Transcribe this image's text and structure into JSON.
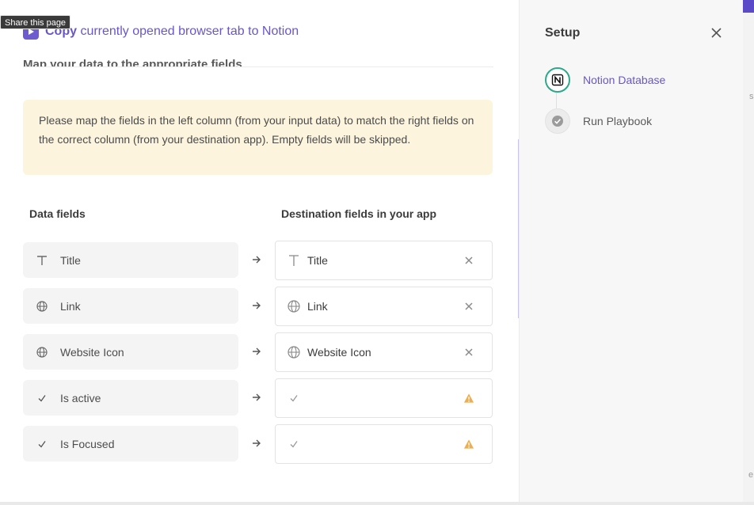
{
  "tooltip": "Share this page",
  "header": {
    "title_strong": "Copy",
    "title_rest": " currently opened browser tab to Notion"
  },
  "section_heading": "Map your data to the appropriate fields",
  "notice": "Please map the fields in the left column (from your input data) to match the right fields on the correct column (from your destination app). Empty fields will be skipped.",
  "columns": {
    "left": "Data fields",
    "right": "Destination fields in your app"
  },
  "rows": [
    {
      "source": "Title",
      "source_icon": "text-icon",
      "destination": "Title",
      "destination_icon": "text-icon",
      "action": "clear-icon"
    },
    {
      "source": "Link",
      "source_icon": "globe-icon",
      "destination": "Link",
      "destination_icon": "globe-icon",
      "action": "clear-icon"
    },
    {
      "source": "Website Icon",
      "source_icon": "globe-icon",
      "destination": "Website Icon",
      "destination_icon": "globe-icon",
      "action": "clear-icon"
    },
    {
      "source": "Is active",
      "source_icon": "check-icon",
      "destination": "",
      "destination_icon": "check-icon",
      "action": "warning-icon"
    },
    {
      "source": "Is Focused",
      "source_icon": "check-icon",
      "destination": "",
      "destination_icon": "check-icon",
      "action": "warning-icon"
    }
  ],
  "sidebar": {
    "title": "Setup",
    "steps": [
      {
        "label": "Notion Database",
        "icon": "notion-icon",
        "state": "active"
      },
      {
        "label": "Run Playbook",
        "icon": "check-circle-icon",
        "state": "pending"
      }
    ]
  },
  "colors": {
    "accent": "#6a56c9",
    "notice_bg": "#fcf4dc",
    "active_step": "#2ea88a",
    "warning": "#f0ad4e"
  },
  "edge_marks": [
    "s",
    "e"
  ]
}
